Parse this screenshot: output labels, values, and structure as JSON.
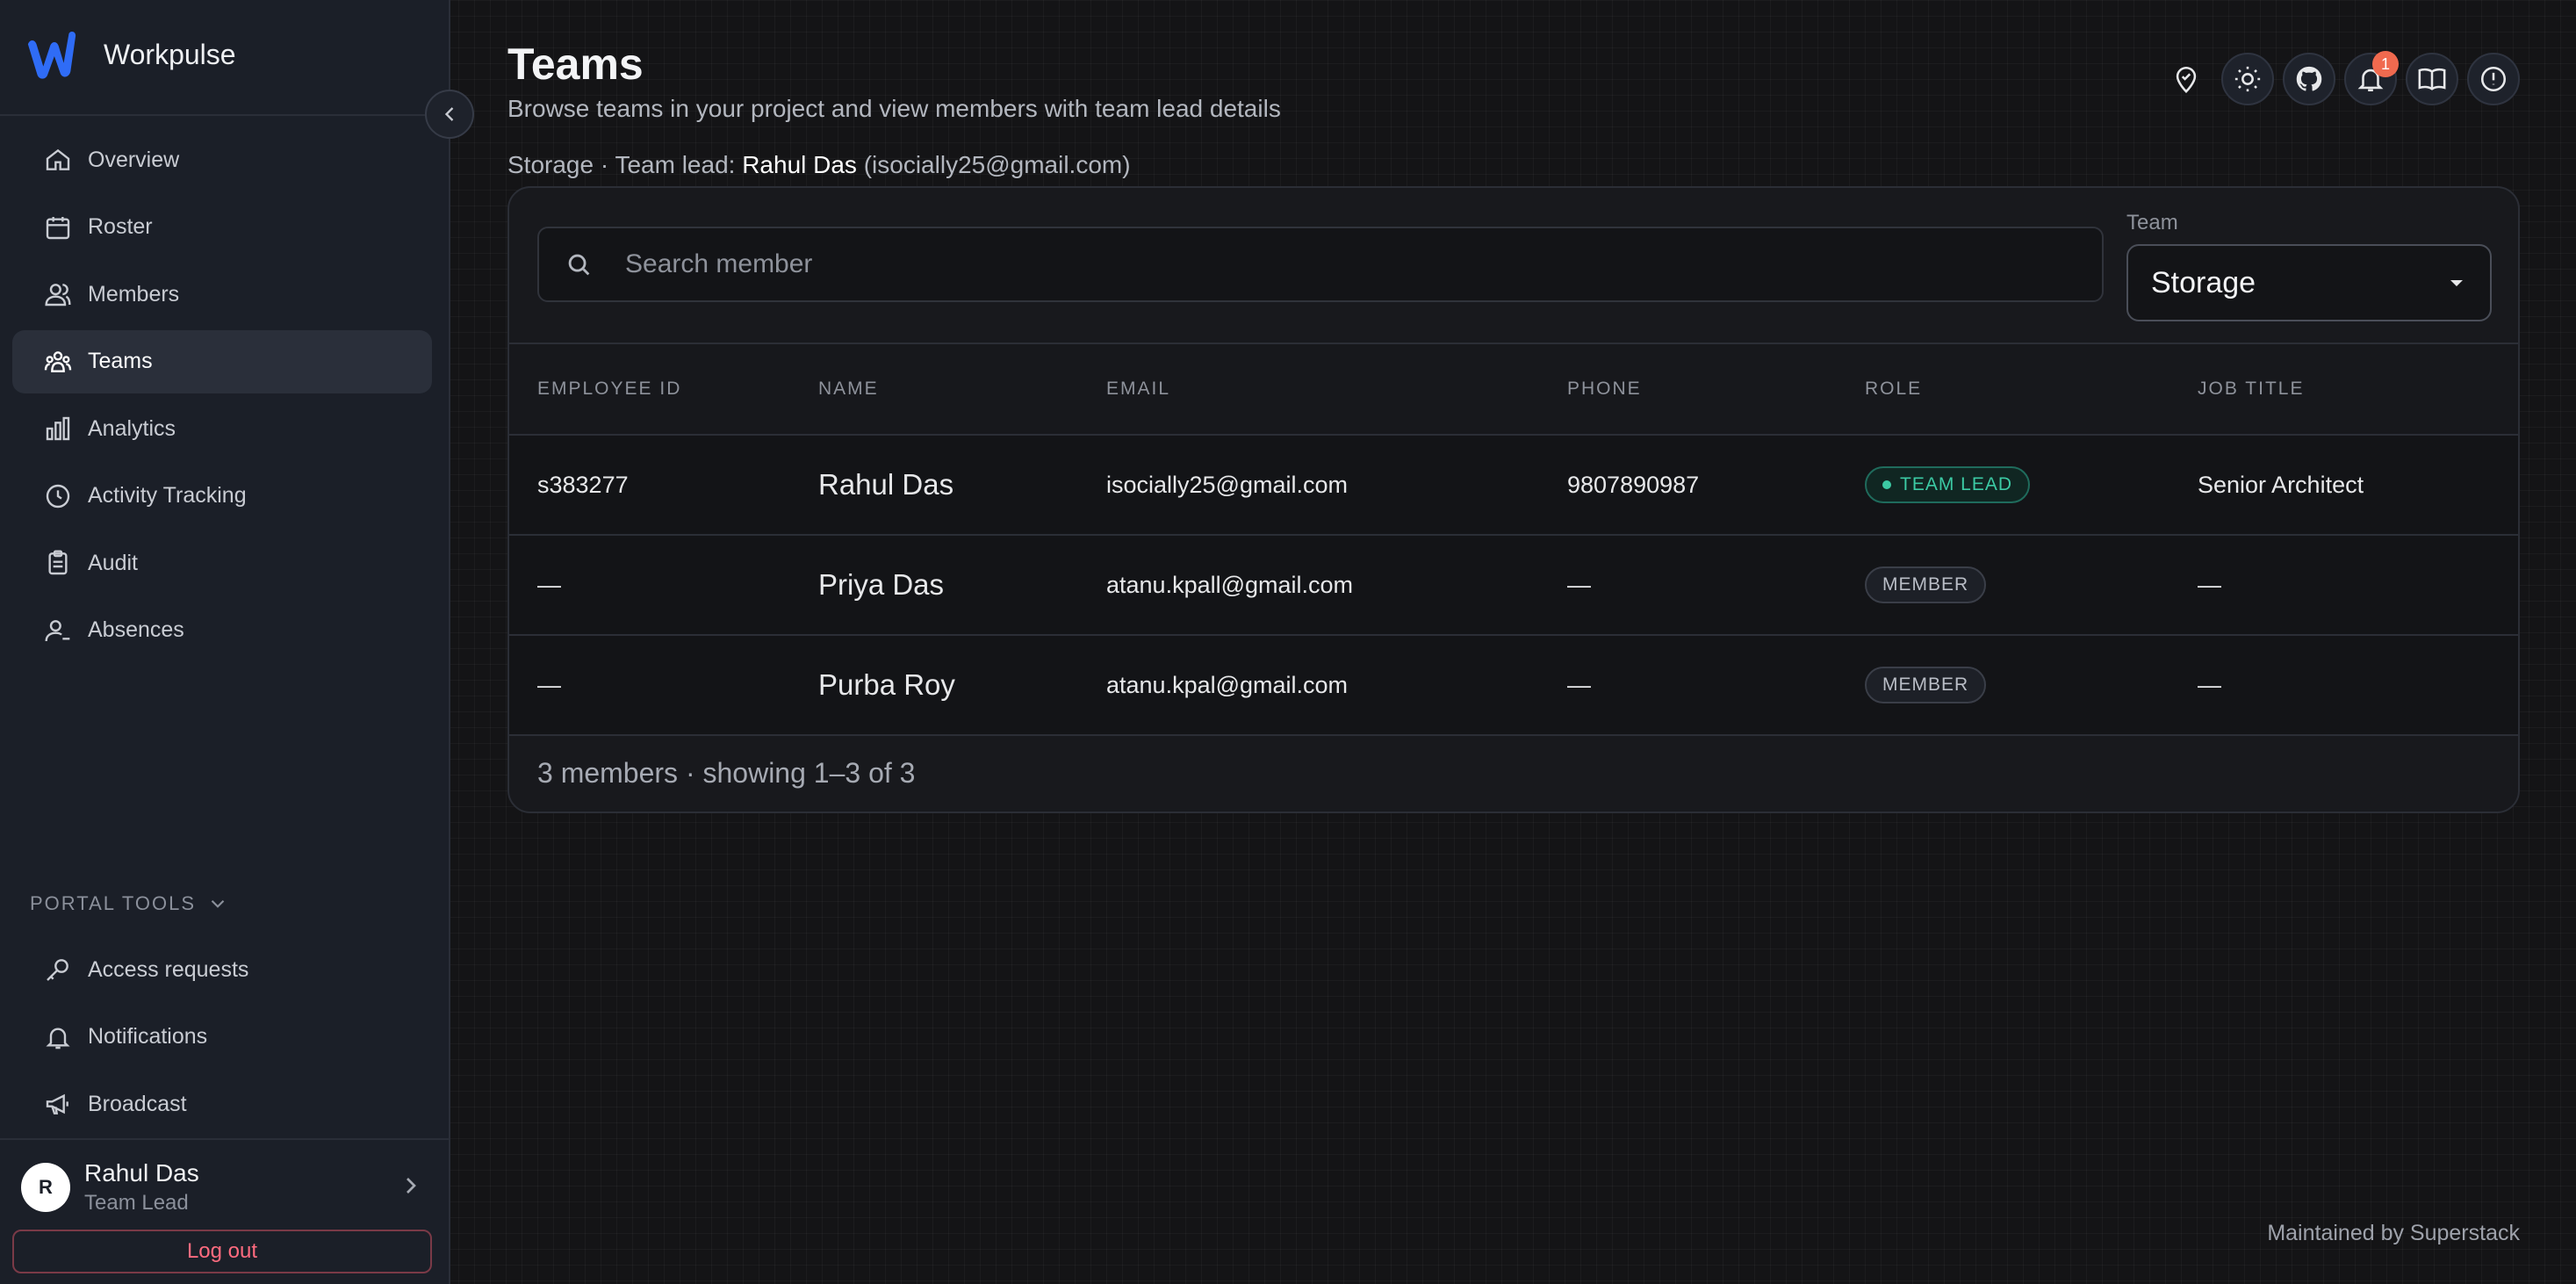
{
  "app": {
    "name": "Workpulse"
  },
  "nav": {
    "items": [
      {
        "label": "Overview",
        "icon": "home-icon"
      },
      {
        "label": "Roster",
        "icon": "calendar-icon"
      },
      {
        "label": "Members",
        "icon": "users-icon"
      },
      {
        "label": "Teams",
        "icon": "team-icon",
        "active": true
      },
      {
        "label": "Analytics",
        "icon": "bar-chart-icon"
      },
      {
        "label": "Activity Tracking",
        "icon": "clock-icon"
      },
      {
        "label": "Audit",
        "icon": "clipboard-icon"
      },
      {
        "label": "Absences",
        "icon": "user-minus-icon"
      }
    ]
  },
  "portal_tools": {
    "header": "PORTAL TOOLS",
    "items": [
      {
        "label": "Access requests",
        "icon": "key-icon"
      },
      {
        "label": "Notifications",
        "icon": "bell-icon"
      },
      {
        "label": "Broadcast",
        "icon": "megaphone-icon"
      }
    ]
  },
  "user": {
    "initial": "R",
    "name": "Rahul Das",
    "role": "Team Lead",
    "logout_label": "Log out"
  },
  "page": {
    "title": "Teams",
    "subtitle": "Browse teams in your project and view members with team lead details",
    "team_name": "Storage",
    "team_lead_prefix": "· Team lead:",
    "team_lead_name": "Rahul Das",
    "team_lead_email": "(isocially25@gmail.com)"
  },
  "topbar": {
    "notification_count": "1"
  },
  "search": {
    "placeholder": "Search member",
    "value": ""
  },
  "team_select": {
    "label": "Team",
    "value": "Storage"
  },
  "table": {
    "headers": [
      "EMPLOYEE ID",
      "NAME",
      "EMAIL",
      "PHONE",
      "ROLE",
      "JOB TITLE"
    ],
    "rows": [
      {
        "id": "s383277",
        "name": "Rahul Das",
        "email": "isocially25@gmail.com",
        "phone": "9807890987",
        "role": "TEAM LEAD",
        "job": "Senior Architect"
      },
      {
        "id": "—",
        "name": "Priya Das",
        "email": "atanu.kpall@gmail.com",
        "phone": "—",
        "role": "MEMBER",
        "job": "—"
      },
      {
        "id": "—",
        "name": "Purba Roy",
        "email": "atanu.kpal@gmail.com",
        "phone": "—",
        "role": "MEMBER",
        "job": "—"
      }
    ],
    "footer": "3 members · showing 1–3 of 3"
  },
  "footer": {
    "maintained": "Maintained by Superstack"
  },
  "colors": {
    "accent": "#3ccaa4",
    "brand_blue": "#2f6cf6",
    "badge": "#f06a4f",
    "logout": "#ff6b7f"
  }
}
